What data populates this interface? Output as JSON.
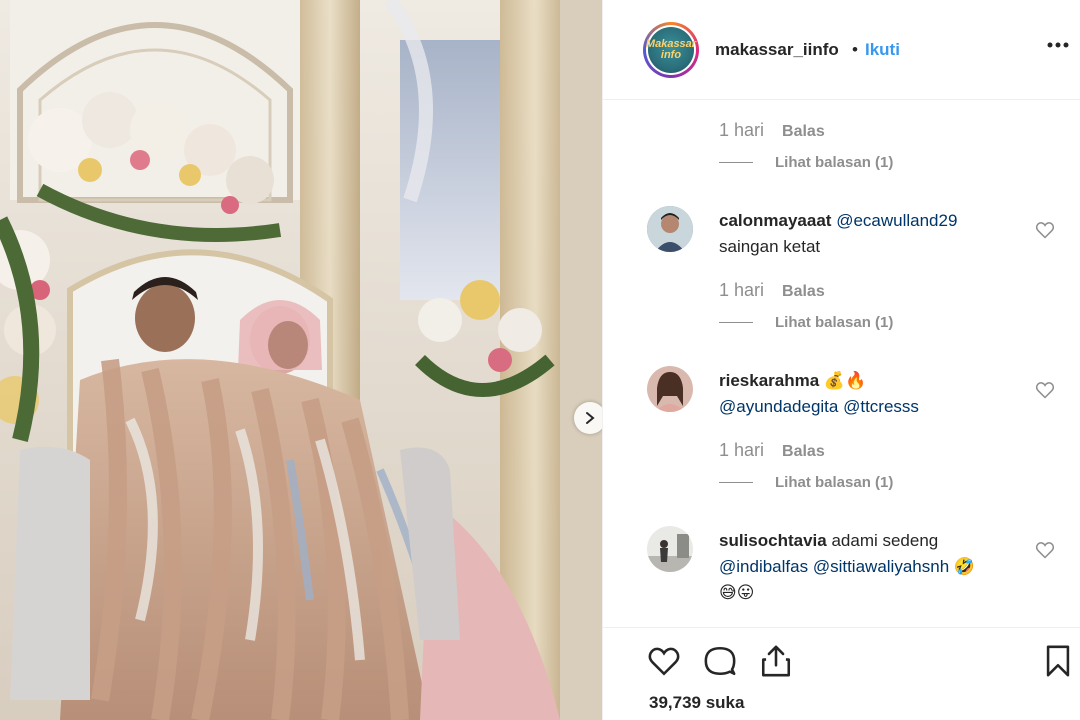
{
  "header": {
    "avatar_text": "Makassar info",
    "username": "makassar_iinfo",
    "separator": "•",
    "follow_label": "Ikuti",
    "more_icon": "more-horizontal-icon"
  },
  "comments": [
    {
      "time": "1 hari",
      "reply_label": "Balas",
      "view_replies": "Lihat balasan (1)"
    },
    {
      "username": "calonmayaaat",
      "text_mention": "@ecawulland29",
      "text_line2": "saingan ketat",
      "time": "1 hari",
      "reply_label": "Balas",
      "view_replies": "Lihat balasan (1)"
    },
    {
      "username": "rieskarahma",
      "emoji": "💰🔥",
      "mention1": "@ayundadegita",
      "mention2": "@ttcresss",
      "time": "1 hari",
      "reply_label": "Balas",
      "view_replies": "Lihat balasan (1)"
    },
    {
      "username": "sulisochtavia",
      "text": "adami sedeng",
      "mention1": "@indibalfas",
      "mention2": "@sittiawaliyahsnh",
      "emoji1": "🤣",
      "emoji2": "😅😛"
    }
  ],
  "actions": {
    "like_icon": "heart-icon",
    "comment_icon": "comment-icon",
    "share_icon": "share-icon",
    "save_icon": "bookmark-icon",
    "likes_text": "39,739 suka"
  },
  "colors": {
    "link_blue": "#3897f0",
    "mention": "#003569",
    "muted": "#8e8e8e",
    "text": "#262626"
  }
}
